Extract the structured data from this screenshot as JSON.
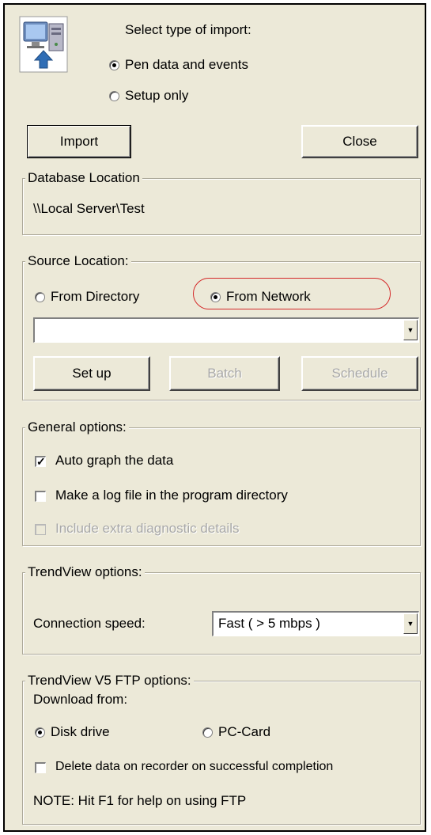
{
  "import_type": {
    "heading": "Select type of import:",
    "options": [
      "Pen data and events",
      "Setup only"
    ],
    "selected": "Pen data and events"
  },
  "buttons": {
    "import": "Import",
    "close": "Close"
  },
  "database_location": {
    "title": "Database Location",
    "value": "\\\\Local Server\\Test"
  },
  "source_location": {
    "title": "Source Location:",
    "options": [
      "From Directory",
      "From Network"
    ],
    "selected": "From Network",
    "path_value": "",
    "buttons": {
      "setup": "Set up",
      "batch": "Batch",
      "schedule": "Schedule"
    },
    "highlight_color": "#d42a2a"
  },
  "general_options": {
    "title": "General options:",
    "items": [
      {
        "label": "Auto graph the data",
        "checked": true,
        "enabled": true
      },
      {
        "label": "Make a log file in the program directory",
        "checked": false,
        "enabled": true
      },
      {
        "label": "Include extra diagnostic details",
        "checked": false,
        "enabled": false
      }
    ]
  },
  "trendview_options": {
    "title": "TrendView options:",
    "speed_label": "Connection speed:",
    "speed_value": "Fast ( > 5 mbps )"
  },
  "ftp_options": {
    "title": "TrendView V5 FTP options:",
    "download_label": "Download from:",
    "options": [
      "Disk drive",
      "PC-Card"
    ],
    "selected": "Disk drive",
    "delete_label": "Delete data on recorder on successful completion",
    "delete_checked": false,
    "note": "NOTE: Hit F1 for help on using FTP"
  },
  "icons": {
    "import_icon": "computer-import-icon"
  }
}
